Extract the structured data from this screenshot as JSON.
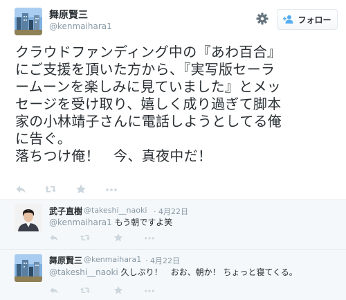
{
  "main_tweet": {
    "author": {
      "name": "舞原賢三",
      "handle": "@kenmaihara1"
    },
    "follow_label": "フォロー",
    "text_lines": [
      "クラウドファンディング中の『あわ百合』",
      "にご支援を頂いた方から、『実写版セーラ",
      "ームーンを楽しみに見ていました』とメッ",
      "セージを受け取り、嬉しく成り過ぎて脚本",
      "家の小林靖子さんに電話しようとしてる俺",
      "に告ぐ。",
      "落ちつけ俺！　今、真夜中だ！"
    ]
  },
  "replies": [
    {
      "author": {
        "name": "武子直樹",
        "handle": "@takeshi__naoki"
      },
      "date": "· 4月22日",
      "mention": "@kenmaihara1",
      "text": " もう朝ですよ笑"
    },
    {
      "author": {
        "name": "舞原賢三",
        "handle": "@kenmaihara1"
      },
      "date": "· 4月22日",
      "mention": "@takeshi__naoki",
      "text": " 久しぶり！　おお、朝か！ ちょっと寝てくる。"
    }
  ],
  "icons": {
    "settings": "gear-icon",
    "follow": "add-user-icon",
    "reply": "reply-icon",
    "retweet": "retweet-icon",
    "favorite": "star-icon",
    "more": "more-icon"
  },
  "colors": {
    "text": "#292f33",
    "muted": "#8899a6",
    "action_icon": "#ccd6dd",
    "reply_background": "#f5f8fa",
    "border": "#e1e8ed"
  }
}
